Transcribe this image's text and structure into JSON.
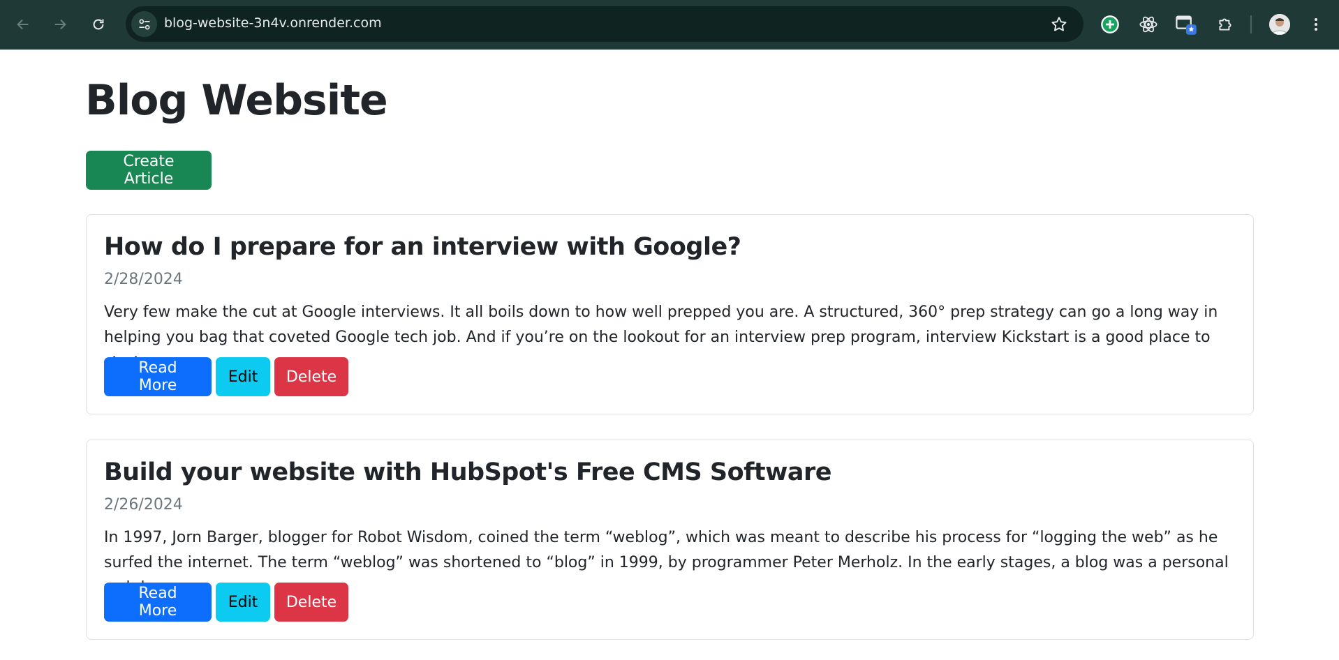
{
  "browser": {
    "url": "blog-website-3n4v.onrender.com"
  },
  "page": {
    "title": "Blog Website",
    "create_label": "Create Article"
  },
  "articles": [
    {
      "title": "How do I prepare for an interview with Google?",
      "date": "2/28/2024",
      "excerpt": "Very few make the cut at Google interviews. It all boils down to how well prepped you are. A structured, 360° prep strategy can go a long way in helping you bag that coveted Google tech job. And if you’re on the lookout for an interview prep program, interview Kickstart is a good place to start. ...",
      "read_label": "Read More",
      "edit_label": "Edit",
      "delete_label": "Delete"
    },
    {
      "title": "Build your website with HubSpot's Free CMS Software",
      "date": "2/26/2024",
      "excerpt": "In 1997, Jorn Barger, blogger for Robot Wisdom, coined the term “weblog”, which was meant to describe his process for “logging the web” as he surfed the internet. The term “weblog” was shortened to “blog” in 1999, by programmer Peter Merholz. In the early stages, a blog was a personal web log or ...",
      "read_label": "Read More",
      "edit_label": "Edit",
      "delete_label": "Delete"
    }
  ],
  "colors": {
    "toolbar": "#1f3a36",
    "omnibox": "#0f2420",
    "success": "#198754",
    "primary": "#0d6efd",
    "info": "#0dcaf0",
    "danger": "#dc3545"
  }
}
